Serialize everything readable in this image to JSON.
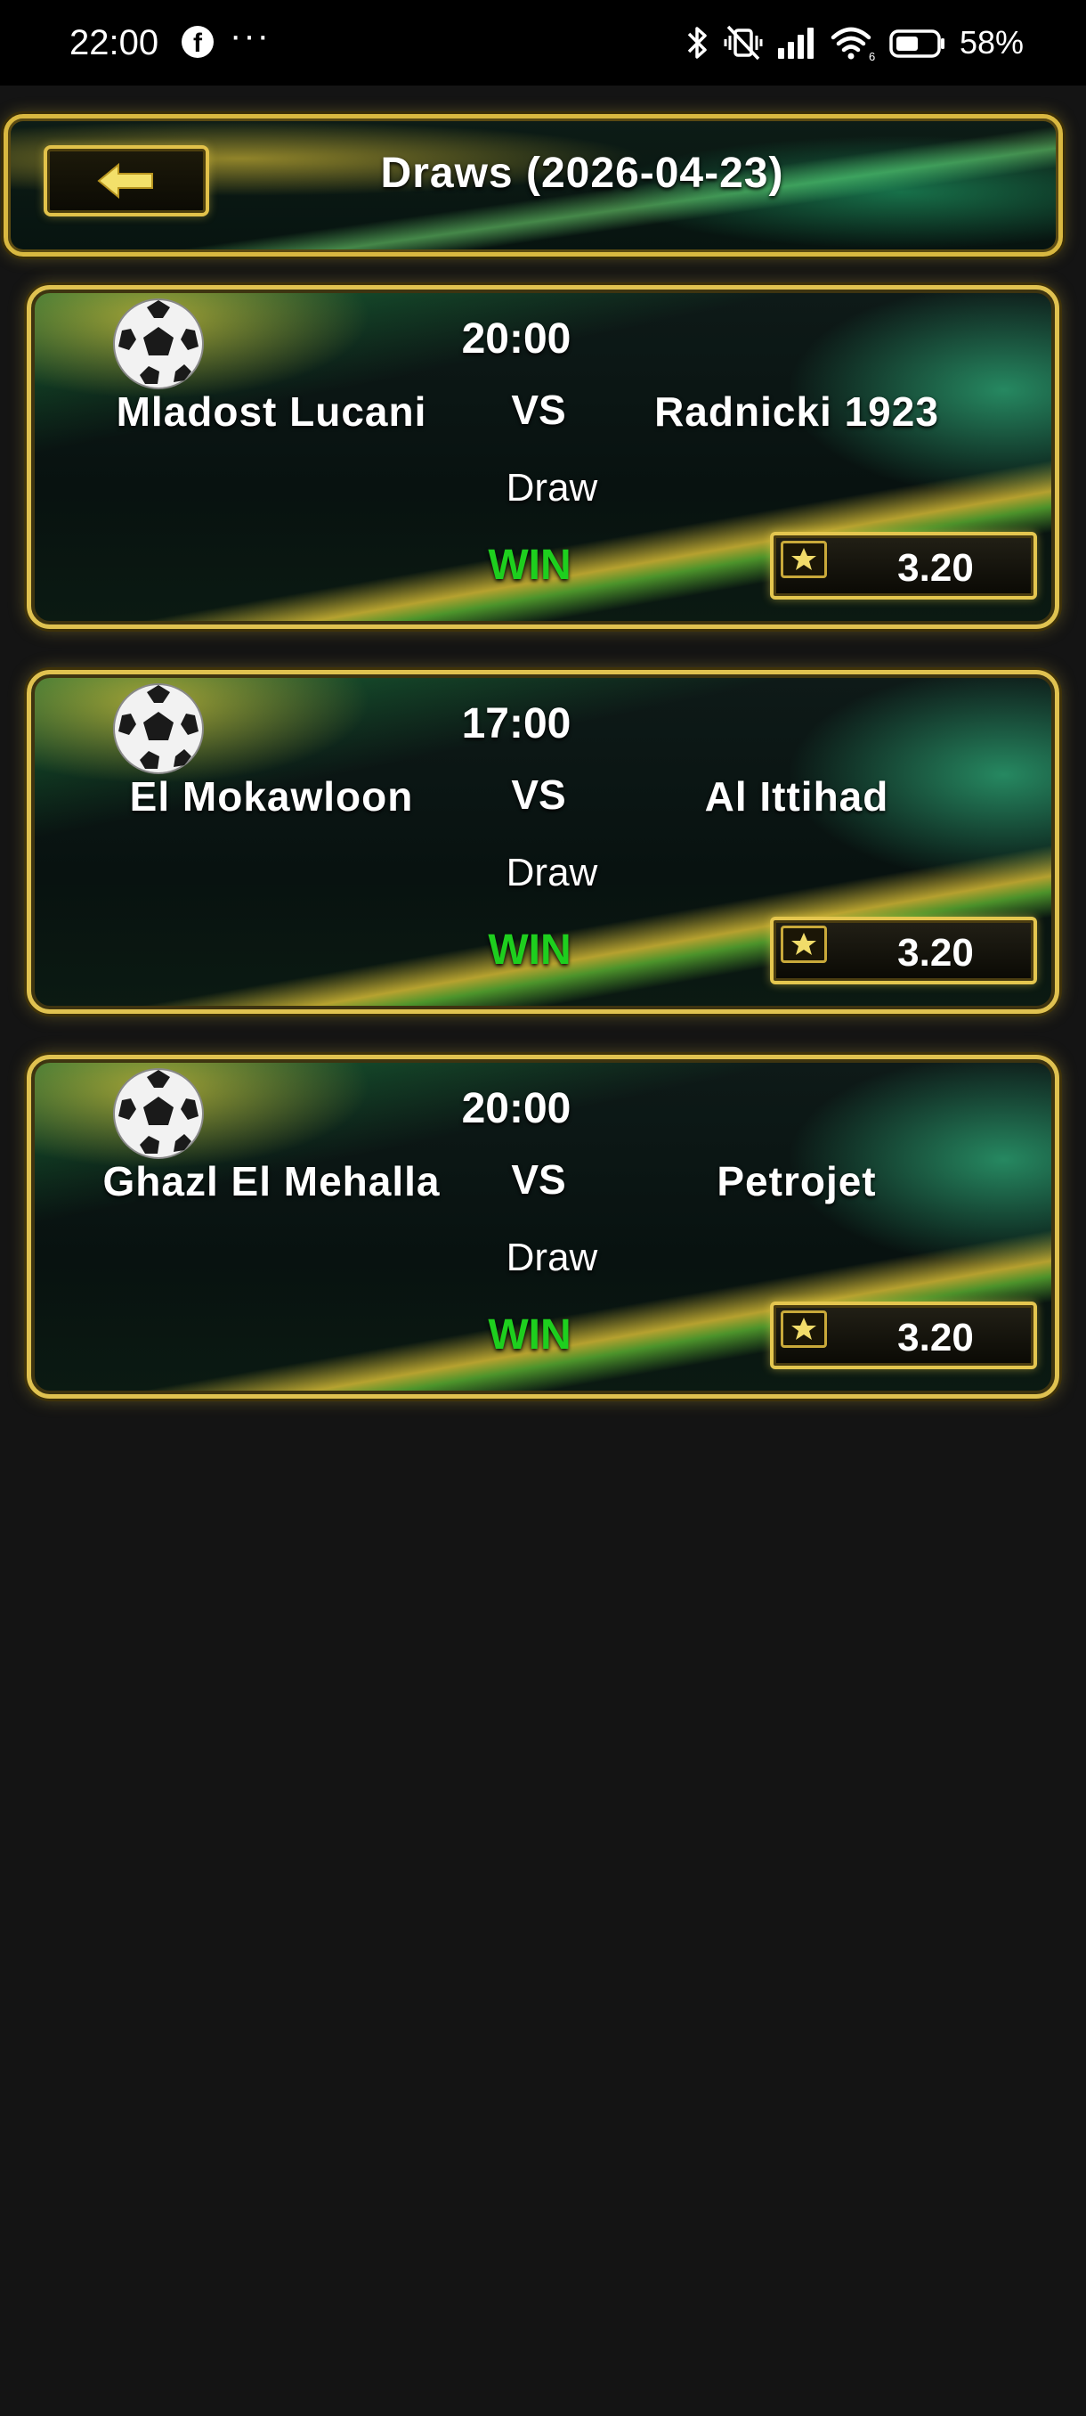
{
  "status_bar": {
    "time": "22:00",
    "facebook_glyph": "f",
    "more_glyph": "···",
    "battery_percent": "58%",
    "icons": [
      "bluetooth-icon",
      "vibrate-off-icon",
      "signal-icon",
      "wifi-icon",
      "battery-icon"
    ]
  },
  "header": {
    "title": "Draws (2026-04-23)",
    "back_icon": "arrow-left-icon"
  },
  "matches": [
    {
      "time": "20:00",
      "home": "Mladost Lucani",
      "vs": "VS",
      "away": "Radnicki 1923",
      "pick": "Draw",
      "result": "WIN",
      "odds": "3.20"
    },
    {
      "time": "17:00",
      "home": "El Mokawloon",
      "vs": "VS",
      "away": "Al Ittihad",
      "pick": "Draw",
      "result": "WIN",
      "odds": "3.20"
    },
    {
      "time": "20:00",
      "home": "Ghazl El Mehalla",
      "vs": "VS",
      "away": "Petrojet",
      "pick": "Draw",
      "result": "WIN",
      "odds": "3.20"
    }
  ],
  "colors": {
    "accent_gold": "#e0c250",
    "win_green": "#1ecf1e",
    "background": "#141414"
  }
}
